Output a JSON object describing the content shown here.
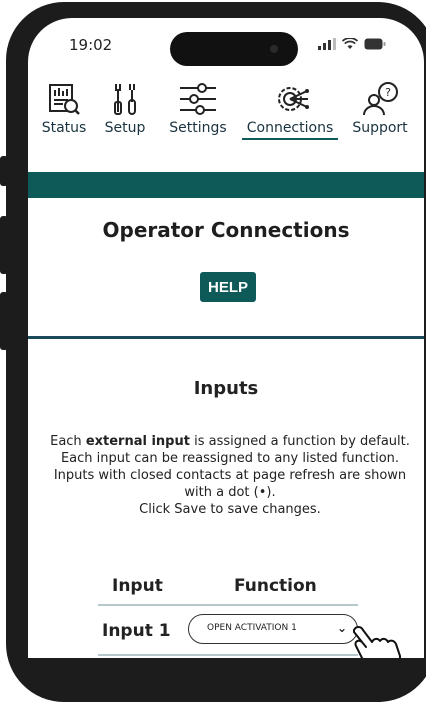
{
  "status_bar": {
    "time": "19:02"
  },
  "nav": {
    "items": [
      {
        "label": "Status",
        "icon": "status-icon"
      },
      {
        "label": "Setup",
        "icon": "tools-icon"
      },
      {
        "label": "Settings",
        "icon": "sliders-icon"
      },
      {
        "label": "Connections",
        "icon": "connections-icon",
        "active": true
      },
      {
        "label": "Support",
        "icon": "support-icon"
      }
    ]
  },
  "page": {
    "title": "Operator Connections",
    "help_label": "HELP"
  },
  "inputs": {
    "title": "Inputs",
    "description": {
      "line1_pre": "Each ",
      "line1_bold": "external input",
      "line1_post": " is assigned a function by default. Each input can be reassigned to any listed function.",
      "line2": "Inputs with closed contacts at page refresh are shown with a dot (•).",
      "line3": "Click Save to save changes."
    },
    "columns": [
      "Input",
      "Function"
    ],
    "rows": [
      {
        "input": "Input 1",
        "function": "OPEN ACTIVATION 1"
      }
    ]
  },
  "colors": {
    "accent": "#0e5a59",
    "divider": "#1a4a57"
  }
}
